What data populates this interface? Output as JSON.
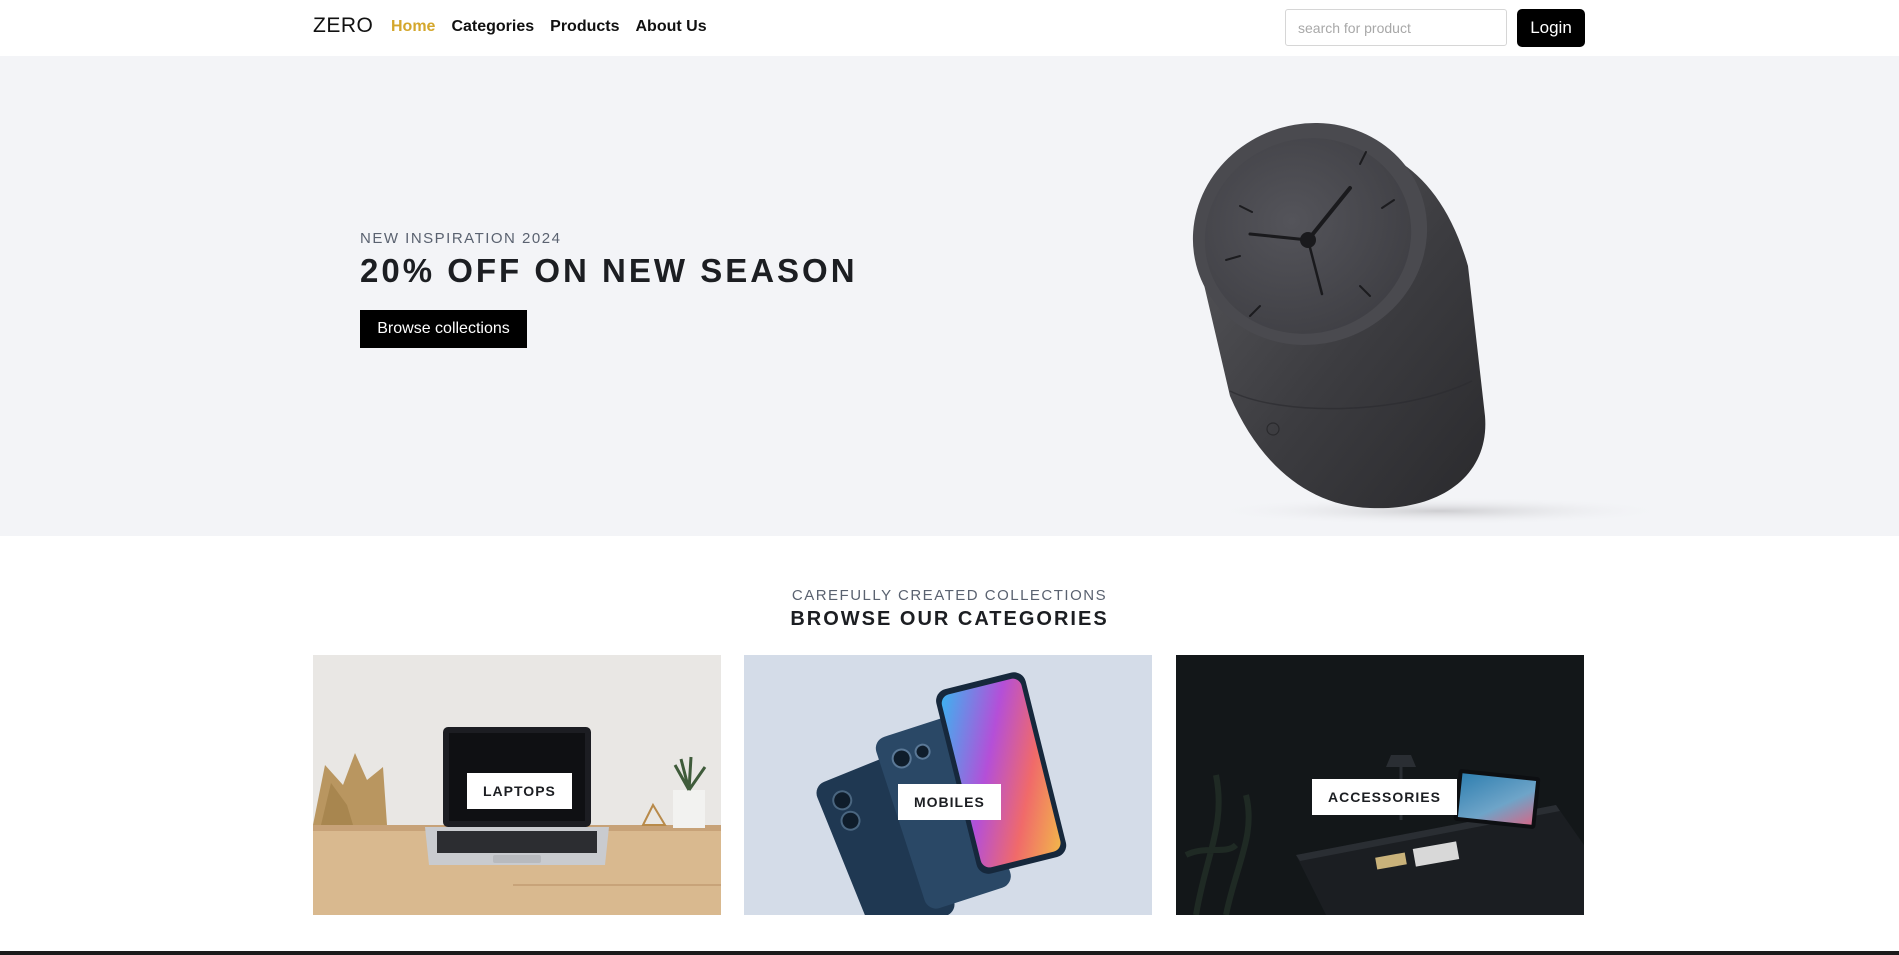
{
  "header": {
    "brand": "ZERO",
    "nav": [
      {
        "label": "Home",
        "active": true
      },
      {
        "label": "Categories",
        "active": false
      },
      {
        "label": "Products",
        "active": false
      },
      {
        "label": "About Us",
        "active": false
      }
    ],
    "search_placeholder": "search for product",
    "login_label": "Login",
    "accent_color": "#d4a72c"
  },
  "hero": {
    "eyebrow": "NEW INSPIRATION 2024",
    "headline": "20% OFF ON NEW SEASON",
    "cta_label": "Browse collections",
    "background": "#f3f4f7"
  },
  "categories": {
    "eyebrow": "CAREFULLY CREATED COLLECTIONS",
    "title": "BROWSE OUR CATEGORIES",
    "items": [
      {
        "label": "LAPTOPS"
      },
      {
        "label": "MOBILES"
      },
      {
        "label": "ACCESSORIES"
      }
    ]
  }
}
